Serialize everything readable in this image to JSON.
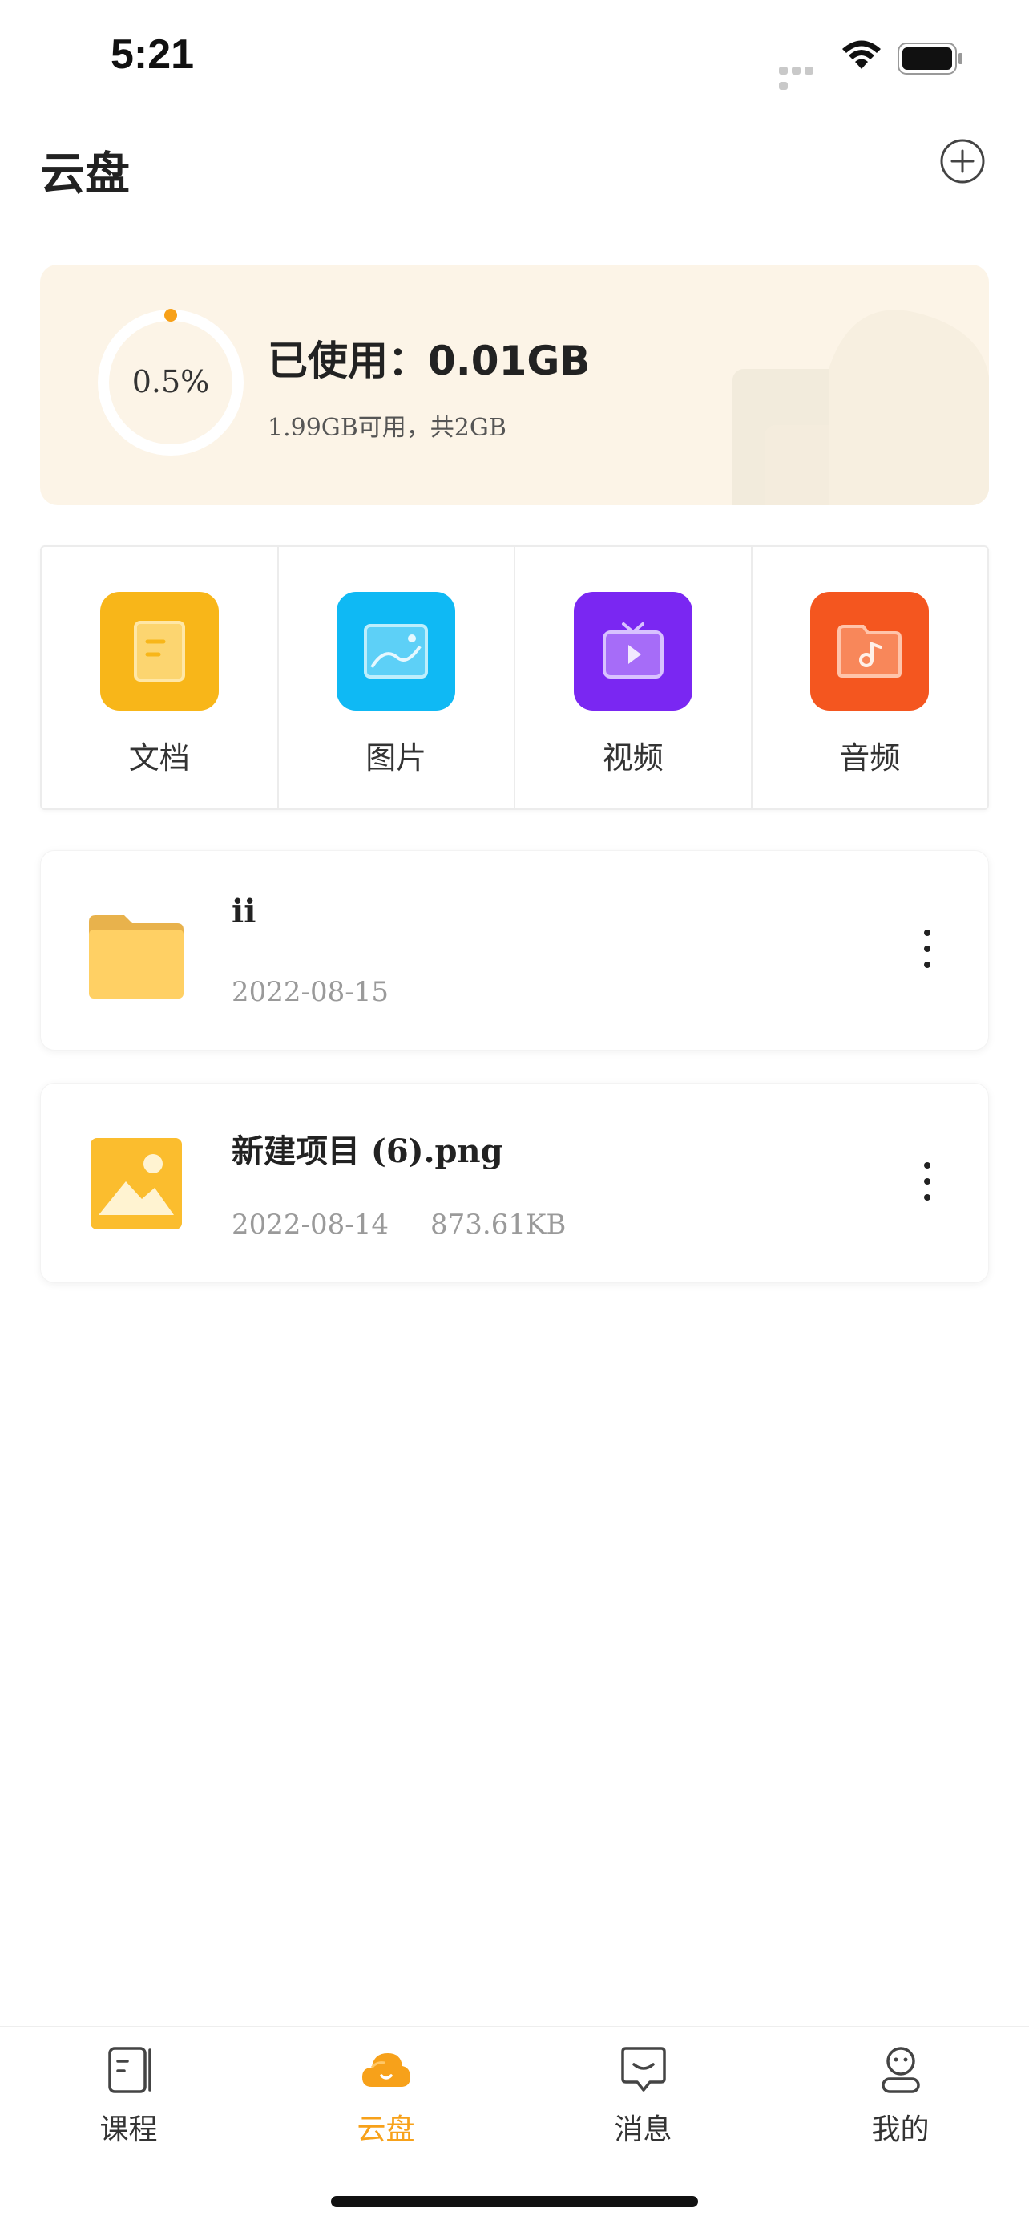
{
  "status_bar": {
    "time": "5:21",
    "icons": [
      "signal-icon",
      "wifi-icon",
      "battery-icon"
    ]
  },
  "header": {
    "title": "云盘",
    "add_icon": "plus-circle-icon"
  },
  "storage": {
    "percent_label": "0.5%",
    "used_fraction": 0.005,
    "used_label": "已使用：0.01GB",
    "sub_label": "1.99GB可用，共2GB"
  },
  "categories": [
    {
      "label": "文档",
      "icon": "document-icon",
      "color": "#f8b619"
    },
    {
      "label": "图片",
      "icon": "image-icon",
      "color": "#0fb9f4"
    },
    {
      "label": "视频",
      "icon": "tv-icon",
      "color": "#7a27f2"
    },
    {
      "label": "音频",
      "icon": "music-folder-icon",
      "color": "#f4561f"
    }
  ],
  "files": [
    {
      "name": "ii",
      "date": "2022-08-15",
      "size": "",
      "type": "folder-icon"
    },
    {
      "name": "新建项目 (6).png",
      "date": "2022-08-14",
      "size": "873.61KB",
      "type": "image-file-icon"
    }
  ],
  "tabbar": {
    "tabs": [
      {
        "label": "课程",
        "icon": "book-icon",
        "active": false
      },
      {
        "label": "云盘",
        "icon": "cloud-icon",
        "active": true
      },
      {
        "label": "消息",
        "icon": "message-icon",
        "active": false
      },
      {
        "label": "我的",
        "icon": "profile-icon",
        "active": false
      }
    ]
  },
  "colors": {
    "accent": "#f7a11a",
    "storage_bg": "#fcf4e7",
    "folder": "#ffd064"
  }
}
